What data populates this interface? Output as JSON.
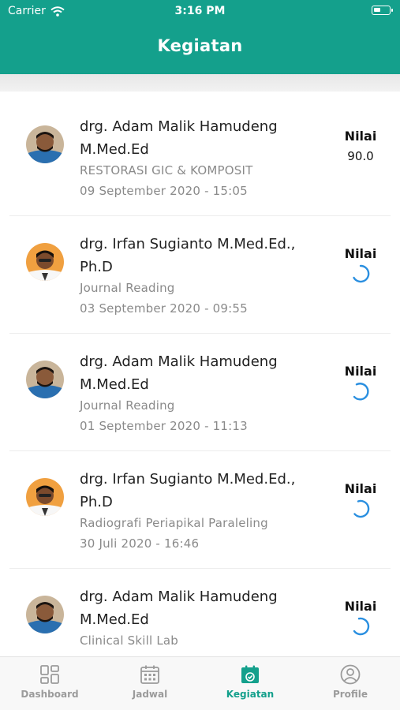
{
  "status_bar": {
    "carrier": "Carrier",
    "time": "3:16 PM"
  },
  "header": {
    "title": "Kegiatan"
  },
  "colors": {
    "brand": "#14a08c",
    "spinner": "#2a8fe0",
    "muted": "#8a8a8a"
  },
  "list": {
    "nilai_label": "Nilai",
    "items": [
      {
        "name_line1": "drg. Adam Malik Hamudeng",
        "name_line2": "M.Med.Ed",
        "subject": "RESTORASI GIC & KOMPOSIT",
        "date": "09 September 2020 - 15:05",
        "nilai": "90.0",
        "status": "graded",
        "avatar": "avatar-adam"
      },
      {
        "name_line1": "drg. Irfan Sugianto M.Med.Ed.,",
        "name_line2": "Ph.D",
        "subject": "Journal Reading",
        "date": "03 September 2020 - 09:55",
        "nilai": "",
        "status": "loading",
        "avatar": "avatar-irfan"
      },
      {
        "name_line1": "drg. Adam Malik Hamudeng",
        "name_line2": "M.Med.Ed",
        "subject": "Journal Reading",
        "date": "01 September 2020 - 11:13",
        "nilai": "",
        "status": "loading",
        "avatar": "avatar-adam"
      },
      {
        "name_line1": "drg. Irfan Sugianto M.Med.Ed.,",
        "name_line2": "Ph.D",
        "subject": "Radiografi Periapikal Paraleling",
        "date": "30 Juli 2020 - 16:46",
        "nilai": "",
        "status": "loading",
        "avatar": "avatar-irfan"
      },
      {
        "name_line1": "drg. Adam Malik Hamudeng",
        "name_line2": "M.Med.Ed",
        "subject": "Clinical Skill Lab",
        "date": "",
        "nilai": "",
        "status": "loading",
        "avatar": "avatar-adam"
      }
    ]
  },
  "tabbar": {
    "tabs": [
      {
        "label": "Dashboard",
        "icon": "dashboard-icon",
        "active": false
      },
      {
        "label": "Jadwal",
        "icon": "calendar-icon",
        "active": false
      },
      {
        "label": "Kegiatan",
        "icon": "calendar-check-icon",
        "active": true
      },
      {
        "label": "Profile",
        "icon": "user-circle-icon",
        "active": false
      }
    ]
  }
}
